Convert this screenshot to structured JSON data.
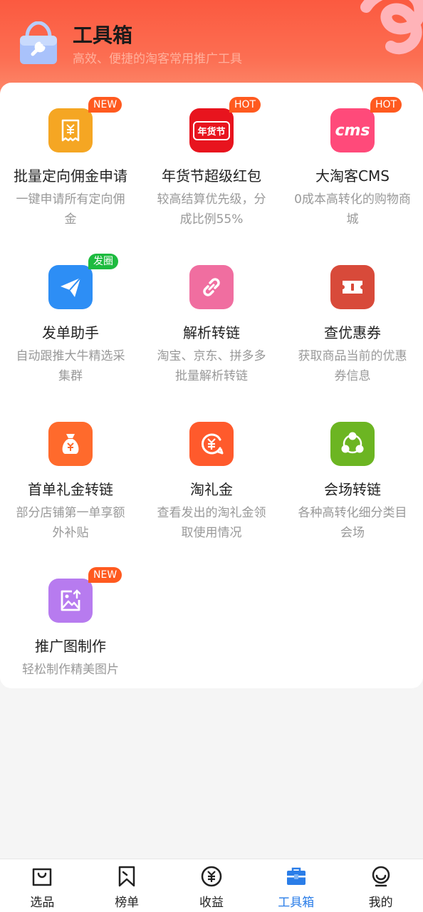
{
  "header": {
    "title": "工具箱",
    "subtitle": "高效、便捷的淘客常用推广工具"
  },
  "colors": {
    "header": "#fb5a40",
    "badge_new": "#ff5a1f",
    "badge_hot": "#ff5a1f",
    "badge_circle": "#1dbb3f",
    "nav_active": "#2a7de8"
  },
  "tools": [
    {
      "name": "批量定向佣金申请",
      "desc": "一键申请所有定向佣金",
      "badge": "NEW",
      "icon": "receipt-yuan-icon",
      "color": "#f5a623"
    },
    {
      "name": "年货节超级红包",
      "desc": "较高结算优先级，分成比例55%",
      "badge": "HOT",
      "icon": "new-year-festival-icon",
      "color": "#e8141e",
      "icon_text": "年货节"
    },
    {
      "name": "大淘客CMS",
      "desc": "0成本高转化的购物商城",
      "badge": "HOT",
      "icon": "cms-icon",
      "color": "#ff4a7a",
      "icon_text": "cms"
    },
    {
      "name": "发单助手",
      "desc": "自动跟推大牛精选采集群",
      "badge": "发圈",
      "icon": "paper-plane-icon",
      "color": "#2d8ef5"
    },
    {
      "name": "解析转链",
      "desc": "淘宝、京东、拼多多批量解析转链",
      "badge": "",
      "icon": "link-icon",
      "color": "#f06ea0"
    },
    {
      "name": "查优惠券",
      "desc": "获取商品当前的优惠券信息",
      "badge": "",
      "icon": "coupon-icon",
      "color": "#d84a3a"
    },
    {
      "name": "首单礼金转链",
      "desc": "部分店铺第一单享额外补贴",
      "badge": "",
      "icon": "money-bag-icon",
      "color": "#ff6a2c"
    },
    {
      "name": "淘礼金",
      "desc": "查看发出的淘礼金领取使用情况",
      "badge": "",
      "icon": "yuan-refresh-icon",
      "color": "#ff5a2c"
    },
    {
      "name": "会场转链",
      "desc": "各种高转化细分类目会场",
      "badge": "",
      "icon": "share-nodes-icon",
      "color": "#6cb522"
    },
    {
      "name": "推广图制作",
      "desc": "轻松制作精美图片",
      "badge": "NEW",
      "icon": "image-upload-icon",
      "color": "#b77bef"
    }
  ],
  "nav": [
    {
      "label": "选品",
      "icon": "shopping-bag-icon",
      "active": false
    },
    {
      "label": "榜单",
      "icon": "bookmark-icon",
      "active": false
    },
    {
      "label": "收益",
      "icon": "yuan-circle-icon",
      "active": false
    },
    {
      "label": "工具箱",
      "icon": "toolbox-icon",
      "active": true
    },
    {
      "label": "我的",
      "icon": "profile-icon",
      "active": false
    }
  ]
}
